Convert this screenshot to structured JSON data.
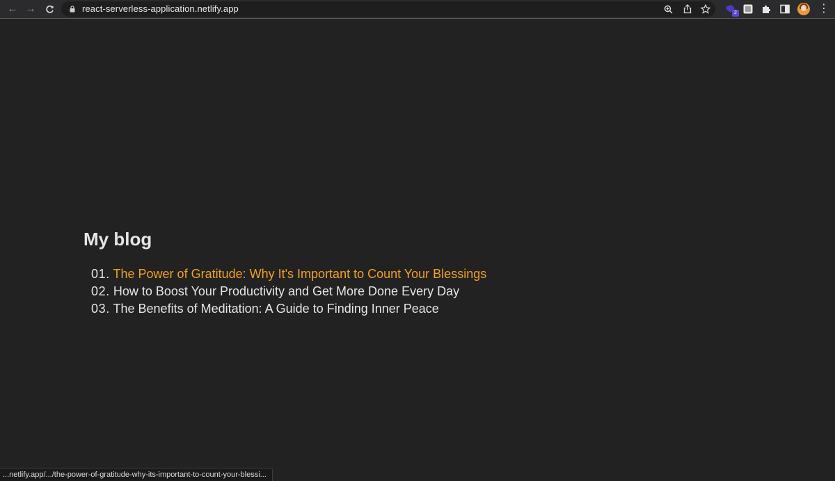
{
  "browser": {
    "url": "react-serverless-application.netlify.app",
    "extension_badge": "2",
    "status_url": "...netlify.app/.../the-power-of-gratitude-why-its-important-to-count-your-blessi...",
    "icons": {
      "back": "arrow-left-icon",
      "forward": "arrow-right-icon",
      "reload": "reload-icon",
      "lock": "lock-icon",
      "zoom": "zoom-icon",
      "share": "share-icon",
      "bookmark": "star-icon",
      "extensions": "puzzle-icon",
      "side_panel": "side-panel-icon",
      "menu": "kebab-menu-icon"
    }
  },
  "page": {
    "title": "My blog",
    "posts": [
      {
        "number": "01.",
        "title": "The Power of Gratitude: Why It's Important to Count Your Blessings",
        "hovered": true
      },
      {
        "number": "02.",
        "title": "How to Boost Your Productivity and Get More Done Every Day",
        "hovered": false
      },
      {
        "number": "03.",
        "title": "The Benefits of Meditation: A Guide to Finding Inner Peace",
        "hovered": false
      }
    ]
  },
  "colors": {
    "background": "#222222",
    "text": "#e6e6e6",
    "link_hover": "#f4a21e",
    "browser_bar": "#2b2b2d"
  }
}
